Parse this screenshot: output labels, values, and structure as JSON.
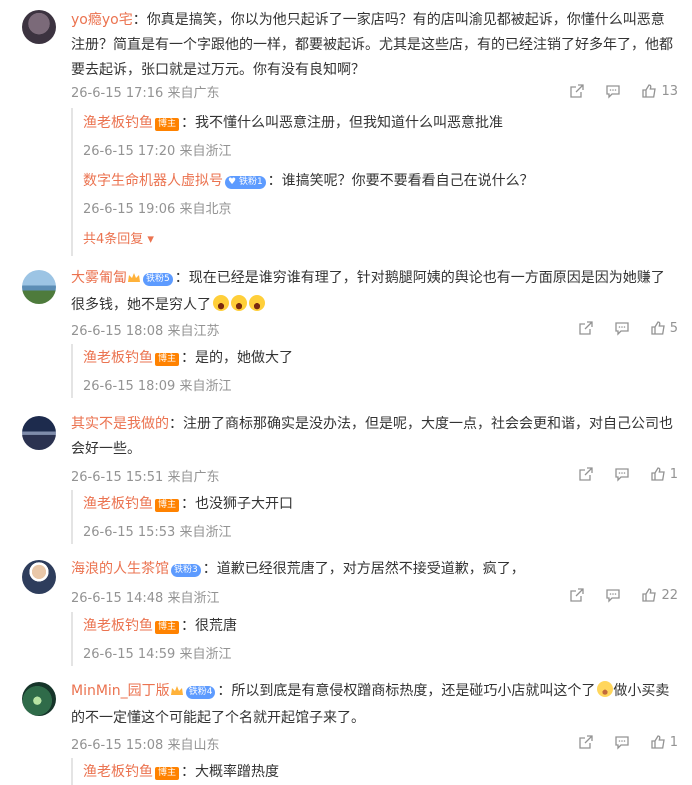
{
  "comments": [
    {
      "user": "yo瘾yo宅",
      "text": "你真是搞笑，你以为他只起诉了一家店吗？有的店叫渝见都被起诉，你懂什么叫恶意注册？简直是有一个字跟他的一样，都要被起诉。尤其是这些店，有的已经注销了好多年了，他都要去起诉，张口就是过万元。你有没有良知啊？",
      "time": "26-6-15 17:16 来自广东",
      "likes": "13",
      "replies": [
        {
          "user": "渔老板钓鱼",
          "badge": "博主",
          "text": "我不懂什么叫恶意注册，但我知道什么叫恶意批准",
          "time": "26-6-15 17:20 来自浙江"
        },
        {
          "user": "数字生命机器人虚拟号",
          "badge": "铁粉1",
          "text": "谁搞笑呢？你要不要看看自己在说什么？",
          "time": "26-6-15 19:06 来自北京"
        }
      ],
      "more": "共4条回复"
    },
    {
      "user": "大雾匍匐",
      "badge": "铁粉5",
      "text": "现在已经是谁穷谁有理了，针对鹅腿阿姨的舆论也有一方面原因是因为她赚了很多钱，她不是穷人了",
      "time": "26-6-15 18:08 来自江苏",
      "likes": "5",
      "replies": [
        {
          "user": "渔老板钓鱼",
          "badge": "博主",
          "text": "是的，她做大了",
          "time": "26-6-15 18:09 来自浙江"
        }
      ]
    },
    {
      "user": "其实不是我做的",
      "text": "注册了商标那确实是没办法，但是呢，大度一点，社会会更和谐，对自己公司也会好一些。",
      "time": "26-6-15 15:51 来自广东",
      "likes": "1",
      "replies": [
        {
          "user": "渔老板钓鱼",
          "badge": "博主",
          "text": "也没狮子大开口",
          "time": "26-6-15 15:53 来自浙江"
        }
      ]
    },
    {
      "user": "海浪的人生茶馆",
      "badge": "铁粉3",
      "text": "道歉已经很荒唐了，对方居然不接受道歉，疯了，",
      "time": "26-6-15 14:48 来自浙江",
      "likes": "22",
      "replies": [
        {
          "user": "渔老板钓鱼",
          "badge": "博主",
          "text": "很荒唐",
          "time": "26-6-15 14:59 来自浙江"
        }
      ]
    },
    {
      "user": "MinMin_园丁版",
      "badge": "铁粉4",
      "text_a": "所以到底是有意侵权蹭商标热度，还是碰巧小店就叫这个了",
      "text_b": "做小买卖的不一定懂这个可能起了个名就开起馆子来了。",
      "time": "26-6-15 15:08 来自山东",
      "likes": "1",
      "replies": [
        {
          "user": "渔老板钓鱼",
          "badge": "博主",
          "text": "大概率蹭热度"
        }
      ]
    }
  ],
  "icons": {
    "share": "share-icon",
    "comment": "comment-icon",
    "like": "thumbs-up-icon"
  },
  "colors": {
    "username": "#eb7350",
    "meta": "#939393",
    "blogger_badge": "#ff8200",
    "fan_badge": "#5d9bff"
  }
}
